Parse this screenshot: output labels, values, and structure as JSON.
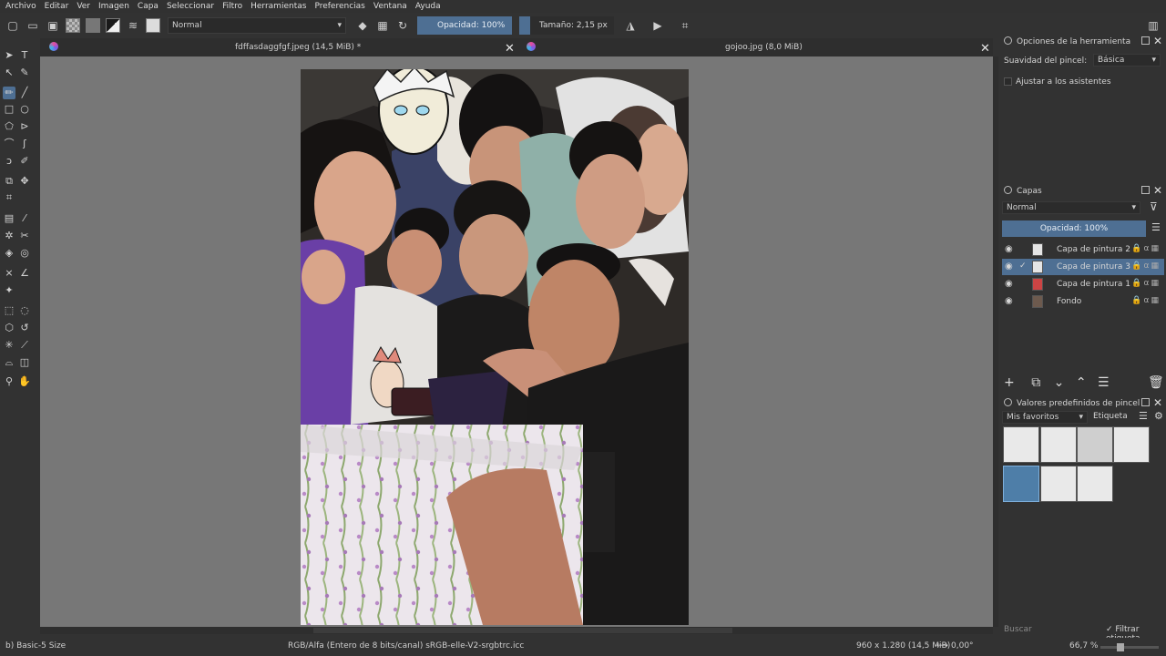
{
  "menu": [
    "Archivo",
    "Editar",
    "Ver",
    "Imagen",
    "Capa",
    "Seleccionar",
    "Filtro",
    "Herramientas",
    "Preferencias",
    "Ventana",
    "Ayuda"
  ],
  "toolbar": {
    "blend_mode": "Normal",
    "opacity": "Opacidad: 100%",
    "size": "Tamaño: 2,15 px"
  },
  "tabs": [
    {
      "title": "fdffasdaggfgf.jpeg (14,5 MiB) *"
    },
    {
      "title": "gojoo.jpg (8,0 MiB)"
    }
  ],
  "tool_options": {
    "title": "Opciones de la herramienta",
    "smoothing_label": "Suavidad del pincel:",
    "smoothing_value": "Básica",
    "assistants_label": "Ajustar a los asistentes"
  },
  "layers": {
    "title": "Capas",
    "blend_mode": "Normal",
    "opacity": "Opacidad:  100%",
    "items": [
      {
        "name": "Capa de pintura 2",
        "selected": false
      },
      {
        "name": "Capa de pintura 3",
        "selected": true
      },
      {
        "name": "Capa de pintura 1",
        "selected": false
      },
      {
        "name": "Fondo",
        "selected": false
      }
    ]
  },
  "brush_presets": {
    "title": "Valores predefinidos de pincel",
    "tag": "Mis favoritos",
    "tag_button": "Etiqueta",
    "search_placeholder": "Buscar",
    "filter_label": "Filtrar etiqueta"
  },
  "status": {
    "brush": "b) Basic-5 Size",
    "color_model": "RGB/Alfa (Entero de 8 bits/canal)  sRGB-elle-V2-srgbtrc.icc",
    "dimensions": "960 x 1.280 (14,5 MiB)",
    "rotation": "0,00°",
    "zoom": "66,7 %"
  },
  "colors": {
    "accent": "#4e6f93",
    "canvas": "#777777",
    "panel": "#323232"
  }
}
